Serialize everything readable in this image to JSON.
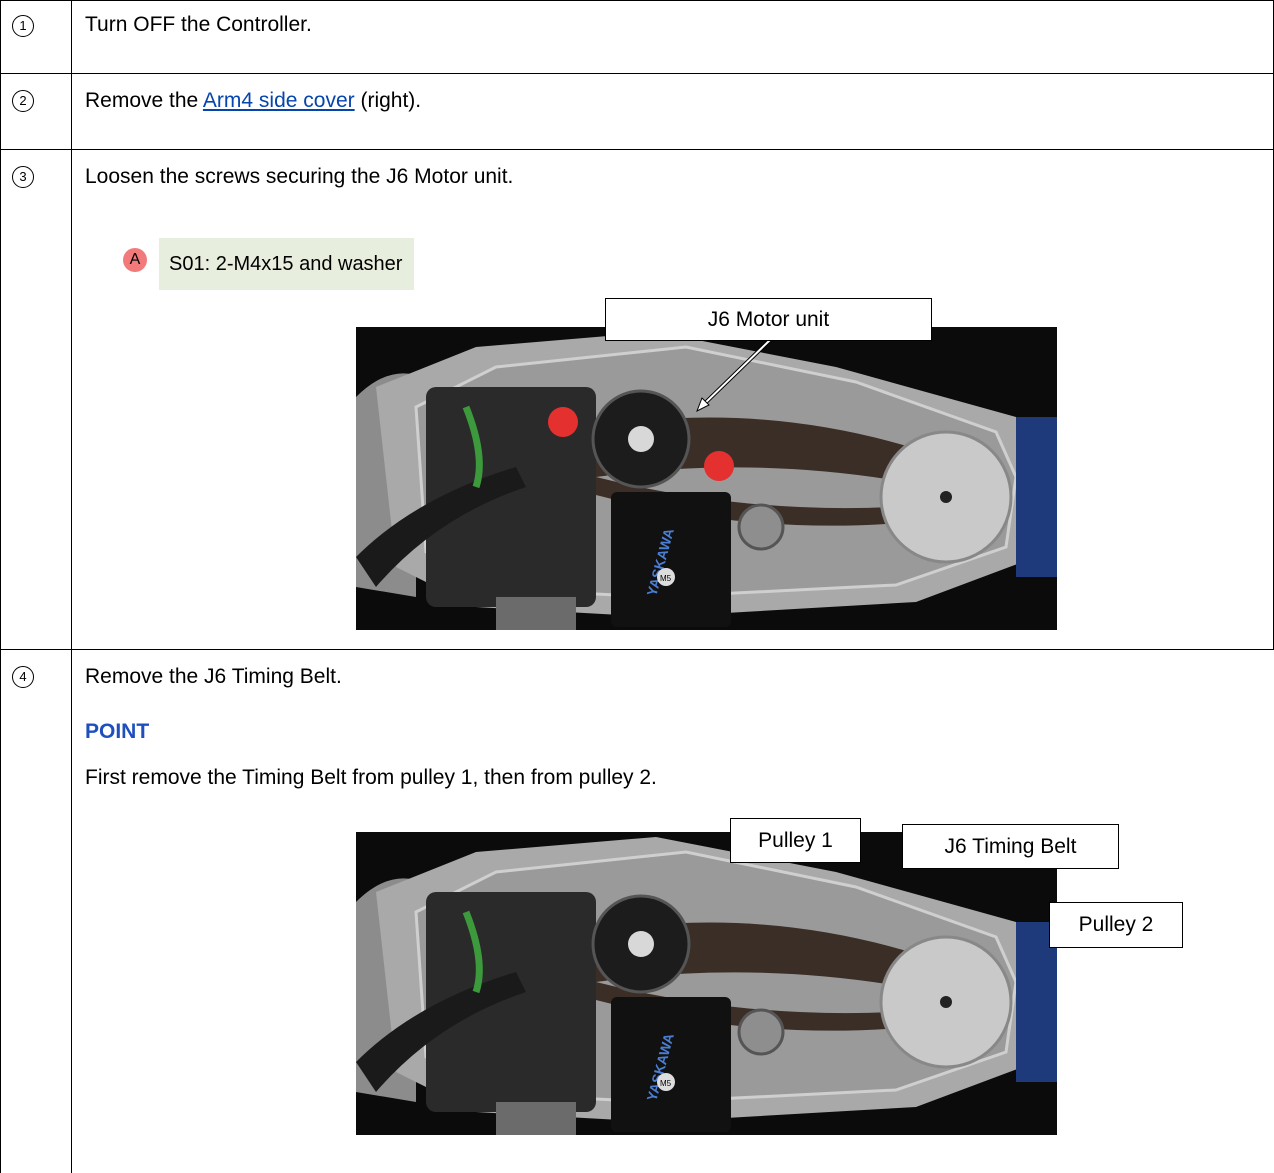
{
  "steps": [
    {
      "number": "1",
      "text": "Turn OFF the Controller."
    },
    {
      "number": "2",
      "text_before": "Remove the ",
      "link": "Arm4 side cover",
      "text_after": " (right)."
    },
    {
      "number": "3",
      "text": "Loosen the screws securing the J6 Motor unit.",
      "screw": {
        "marker": "A",
        "label": "S01: 2-M4x15 and washer"
      },
      "photo_callouts": [
        "J6 Motor unit"
      ]
    },
    {
      "number": "4",
      "text": "Remove the J6 Timing Belt.",
      "point_heading": "POINT",
      "point_text": "First remove the Timing Belt from pulley 1, then from pulley 2.",
      "photo_callouts": [
        "Pulley 1",
        "J6 Timing Belt",
        "Pulley 2"
      ]
    }
  ],
  "photo_labels": {
    "brand": "YASKAWA",
    "part": "M5"
  },
  "colors": {
    "link": "#0645ad",
    "point_heading": "#1f4fbf",
    "marker": "#f27a7a",
    "screw_box": "#e8eedd",
    "highlight_screw": "#e03030"
  }
}
